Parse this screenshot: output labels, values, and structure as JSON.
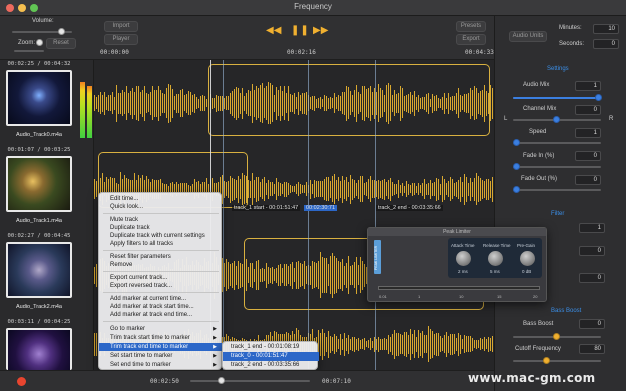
{
  "window": {
    "title": "Frequency"
  },
  "topbar": {
    "volume_label": "Volume:",
    "zoom_label": "Zoom:",
    "reset_label": "Reset",
    "import_label": "Import",
    "player_label": "Player",
    "time_start": "00:00:00",
    "time_current": "00:02:16",
    "time_end": "00:04:33",
    "presets_label": "Presets",
    "export_label": "Export",
    "audio_units_label": "Audio Units"
  },
  "right_panel": {
    "minutes_label": "Minutes:",
    "minutes_value": "10",
    "seconds_label": "Seconds:",
    "seconds_value": "0",
    "settings_heading": "Settings",
    "audio_mix_label": "Audio Mix",
    "audio_mix_value": "1",
    "channel_mix_label": "Channel Mix",
    "channel_mix_value": "0",
    "left_label": "L",
    "right_label": "R",
    "speed_label": "Speed",
    "speed_value": "1",
    "fade_in_label": "Fade In (%)",
    "fade_in_value": "0",
    "fade_out_label": "Fade Out (%)",
    "fade_out_value": "0",
    "filter_heading": "Filter",
    "filter_value": "1",
    "filter_value_2": "0",
    "filter_value_3": "0",
    "bass_heading": "Bass Boost",
    "bass_boost_label": "Bass Boost",
    "bass_boost_value": "0",
    "cutoff_label": "Cutoff Frequency",
    "cutoff_value": "80"
  },
  "clips": [
    {
      "range": "00:02:25 / 00:04:32",
      "name": "Audio_Track0.m4a"
    },
    {
      "range": "00:01:07 / 00:03:25",
      "name": "Audio_Track1.m4a"
    },
    {
      "range": "00:02:27 / 00:04:45",
      "name": "Audio_Track2.m4a"
    },
    {
      "range": "00:03:11 / 00:04:25",
      "name": ""
    }
  ],
  "markers": {
    "track1_start": "track_1 start - 00:01:51:47",
    "selected_time": "00:02:30:71",
    "track2_end": "track_2 end - 00:03:35:66"
  },
  "context_menu": {
    "items": [
      "Edit time...",
      "Quick look...",
      "Mute track",
      "Duplicate track",
      "Duplicate track with current settings",
      "Apply filters to all tracks",
      "Reset filter parameters",
      "Remove",
      "Export current track...",
      "Export reversed track...",
      "Add marker at current time...",
      "Add marker at track start time...",
      "Add marker at track end time...",
      "Go to marker",
      "Trim track start time to marker",
      "Trim track end time to marker",
      "Set start time to marker",
      "Set end time to marker"
    ]
  },
  "submenu": {
    "items": [
      "track_1 end - 00:01:08:19",
      "track_0 - 00:01:51:47",
      "track_2 end - 00:03:35:66"
    ]
  },
  "peak_limiter": {
    "title": "Peak Limiter",
    "side_label": "PEAK LIMITER",
    "attack_label": "Attack Time",
    "release_label": "Release Time",
    "pregain_label": "Pre-Gain",
    "attack_value": "2 ms",
    "release_value": "5 ms",
    "pregain_value": "0 dB",
    "scale_ticks": [
      "0.01",
      "1",
      "10",
      "15",
      "20"
    ]
  },
  "bottombar": {
    "time_left": "00:02:50",
    "time_right": "00:07:10"
  },
  "watermark": "www.mac-gm.com",
  "colors": {
    "accent": "#3b7fe0",
    "wave": "#d8a830",
    "record": "#e8452f",
    "section": "#3b8fe8"
  }
}
